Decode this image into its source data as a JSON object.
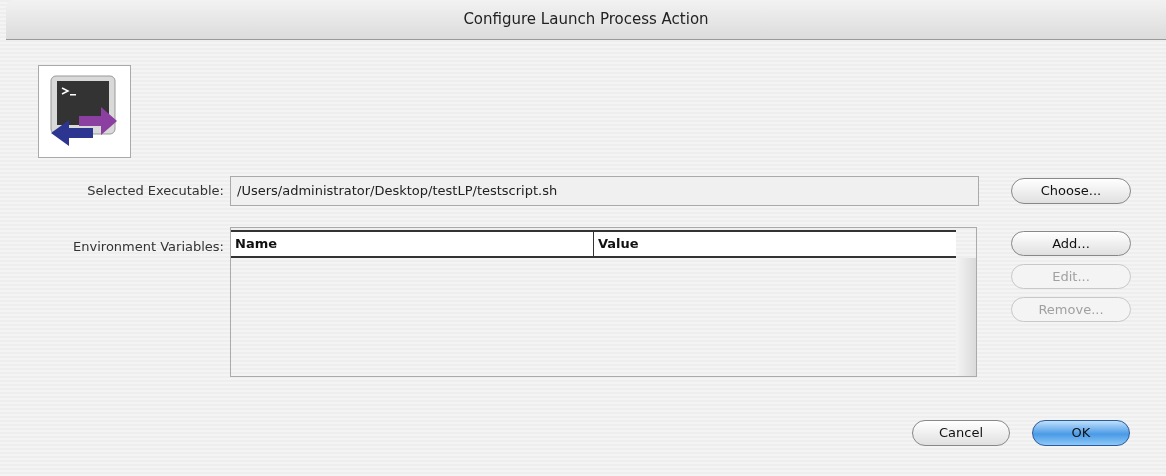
{
  "window": {
    "title": "Configure Launch Process Action"
  },
  "executable": {
    "label": "Selected Executable:",
    "value": "/Users/administrator/Desktop/testLP/testscript.sh",
    "button": "Choose..."
  },
  "environment": {
    "label": "Environment Variables:",
    "table": {
      "columns": [
        "Name",
        "Value"
      ]
    },
    "buttons": [
      {
        "label": "Add...",
        "disabled": false
      },
      {
        "label": "Edit...",
        "disabled": true
      },
      {
        "label": "Remove...",
        "disabled": true
      }
    ]
  },
  "buttons": [
    {
      "label": "Cancel",
      "default": false
    },
    {
      "label": "OK",
      "default": true
    }
  ]
}
